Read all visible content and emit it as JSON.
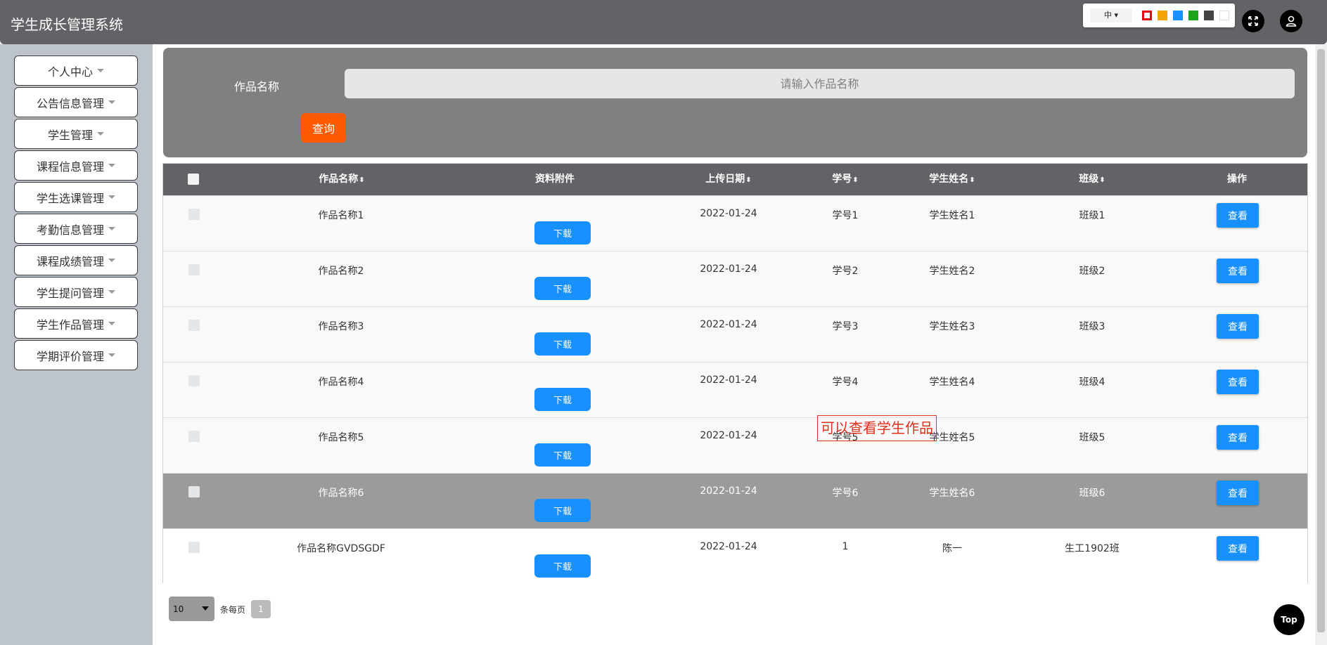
{
  "header": {
    "title": "学生成长管理系统",
    "lang_label": "中",
    "theme_colors": [
      "#e60012",
      "#f5a300",
      "#1890ff",
      "#1aa41a",
      "#444444",
      "#ffffff"
    ],
    "fullscreen_icon": "expand-arrows-icon",
    "user_icon": "user-avatar-icon"
  },
  "sidebar": {
    "items": [
      {
        "label": "个人中心"
      },
      {
        "label": "公告信息管理"
      },
      {
        "label": "学生管理"
      },
      {
        "label": "课程信息管理"
      },
      {
        "label": "学生选课管理"
      },
      {
        "label": "考勤信息管理"
      },
      {
        "label": "课程成绩管理"
      },
      {
        "label": "学生提问管理"
      },
      {
        "label": "学生作品管理"
      },
      {
        "label": "学期评价管理"
      }
    ]
  },
  "search": {
    "label": "作品名称",
    "placeholder": "请输入作品名称",
    "value": "",
    "query_label": "查询"
  },
  "table": {
    "columns": [
      "作品名称",
      "资料附件",
      "上传日期",
      "学号",
      "学生姓名",
      "班级",
      "操作"
    ],
    "download_label": "下载",
    "view_label": "查看",
    "rows": [
      {
        "name": "作品名称1",
        "date": "2022-01-24",
        "student_id": "学号1",
        "student_name": "学生姓名1",
        "class": "班级1"
      },
      {
        "name": "作品名称2",
        "date": "2022-01-24",
        "student_id": "学号2",
        "student_name": "学生姓名2",
        "class": "班级2"
      },
      {
        "name": "作品名称3",
        "date": "2022-01-24",
        "student_id": "学号3",
        "student_name": "学生姓名3",
        "class": "班级3"
      },
      {
        "name": "作品名称4",
        "date": "2022-01-24",
        "student_id": "学号4",
        "student_name": "学生姓名4",
        "class": "班级4"
      },
      {
        "name": "作品名称5",
        "date": "2022-01-24",
        "student_id": "学号5",
        "student_name": "学生姓名5",
        "class": "班级5"
      },
      {
        "name": "作品名称6",
        "date": "2022-01-24",
        "student_id": "学号6",
        "student_name": "学生姓名6",
        "class": "班级6"
      },
      {
        "name": "作品名称GVDSGDF",
        "date": "2022-01-24",
        "student_id": "1",
        "student_name": "陈一",
        "class": "生工1902班"
      }
    ]
  },
  "annotation": "可以查看学生作品",
  "pagination": {
    "page_size": "10",
    "per_page_label": "条每页",
    "current_page": "1"
  },
  "top_button": "Top"
}
